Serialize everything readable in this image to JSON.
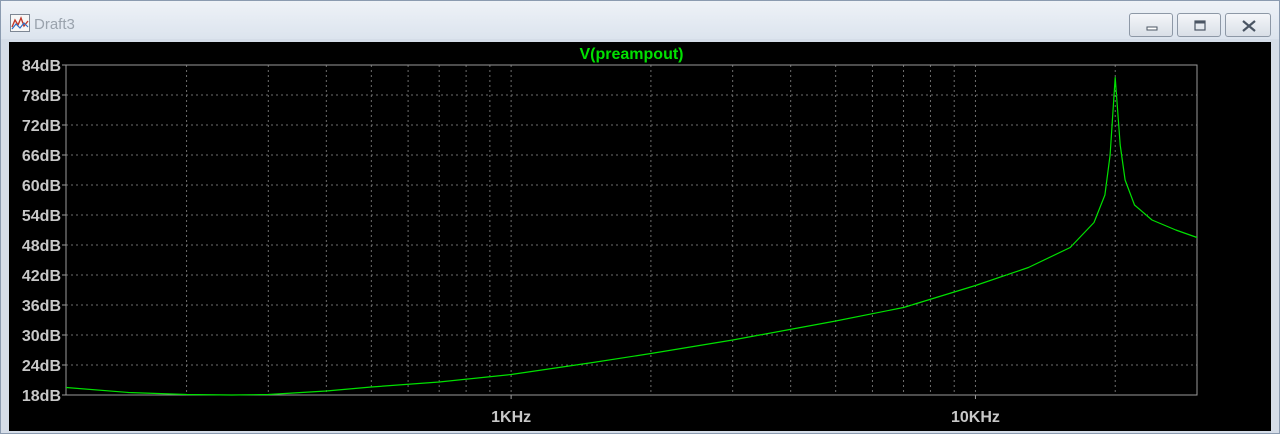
{
  "window": {
    "title": "Draft3",
    "icons": {
      "app": "waveform-icon",
      "minimize": "minimize-icon",
      "maximize": "maximize-icon",
      "close": "close-icon"
    }
  },
  "colors": {
    "background": "#000000",
    "trace": "#00e000",
    "grid": "#6e6e6e",
    "text": "#c8c8c8",
    "title": "#00e000"
  },
  "chart_data": {
    "type": "line",
    "title": "V(preampout)",
    "xscale": "log",
    "xlim": [
      110,
      30000
    ],
    "ylim": [
      18,
      84
    ],
    "yticks": [
      18,
      24,
      30,
      36,
      42,
      48,
      54,
      60,
      66,
      72,
      78,
      84
    ],
    "ytick_labels": [
      "18dB",
      "24dB",
      "30dB",
      "36dB",
      "42dB",
      "48dB",
      "54dB",
      "60dB",
      "66dB",
      "72dB",
      "78dB",
      "84dB"
    ],
    "xticks": [
      1000,
      10000
    ],
    "xtick_labels": [
      "1KHz",
      "10KHz"
    ],
    "grid": true,
    "series": [
      {
        "name": "V(preampout)",
        "x": [
          110,
          150,
          200,
          250,
          300,
          400,
          500,
          700,
          1000,
          1500,
          2000,
          3000,
          5000,
          7000,
          10000,
          13000,
          16000,
          18000,
          19000,
          19500,
          20000,
          20500,
          21000,
          22000,
          24000,
          27000,
          30000
        ],
        "y": [
          19.5,
          18.5,
          18.1,
          18.0,
          18.1,
          18.8,
          19.6,
          20.6,
          22.1,
          24.5,
          26.3,
          29.0,
          32.8,
          35.5,
          39.9,
          43.5,
          47.5,
          52.5,
          58.0,
          66.0,
          81.5,
          68.0,
          61.0,
          56.0,
          53.0,
          51.0,
          49.5
        ]
      }
    ]
  }
}
